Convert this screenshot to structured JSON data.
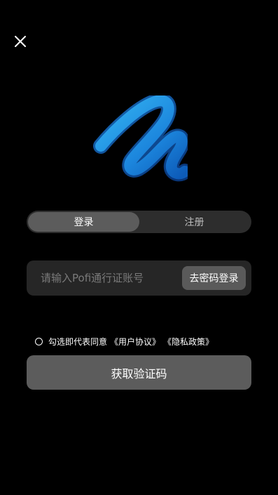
{
  "icons": {
    "close": "close-icon",
    "logo": "pofi-logo",
    "radio": "radio-unchecked-icon"
  },
  "colors": {
    "background": "#000000",
    "logo_light": "#29a9ee",
    "logo_dark": "#0d5bb8",
    "button": "#5c5c5c"
  },
  "tabs": {
    "login_label": "登录",
    "register_label": "注册",
    "active": "登录"
  },
  "account_input": {
    "placeholder": "请输入Pofi通行证账号",
    "value": ""
  },
  "password_login_button": "去密码登录",
  "agreement": {
    "checked": false,
    "text": "勾选即代表同意",
    "user_agreement": "《用户协议》",
    "privacy_policy": "《隐私政策》"
  },
  "submit_button": "获取验证码"
}
